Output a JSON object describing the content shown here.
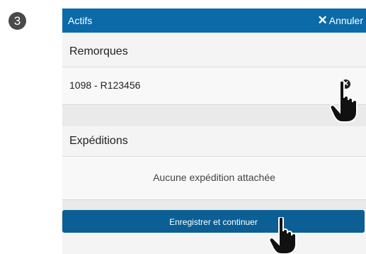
{
  "step_number": "3",
  "header": {
    "title": "Actifs",
    "cancel_icon": "close-icon",
    "cancel_label": "Annuler",
    "color": "#0b6aa8"
  },
  "trailers": {
    "title": "Remorques",
    "items": [
      {
        "label": "1098 - R123456",
        "remove_icon": "remove-circle-icon"
      }
    ]
  },
  "shipments": {
    "title": "Expéditions",
    "empty_text": "Aucune expédition attachée"
  },
  "save_button": {
    "label": "Enregistrer et continuer",
    "color": "#0b5f95"
  },
  "pointer_icon": "hand-pointer-icon"
}
